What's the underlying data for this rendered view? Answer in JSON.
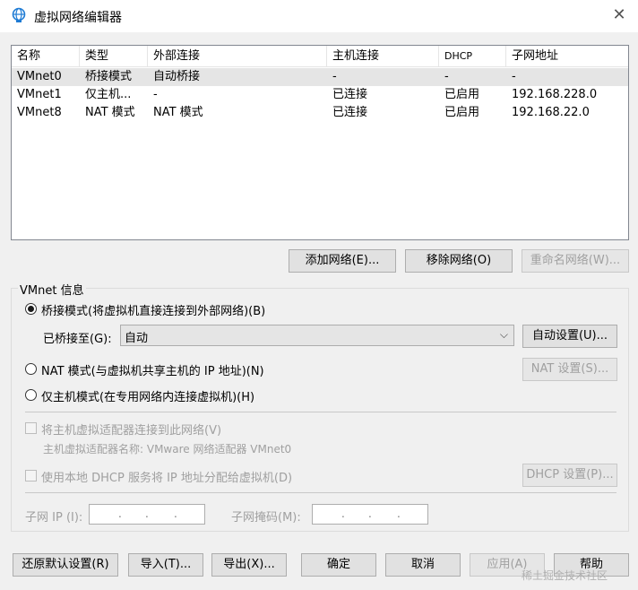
{
  "window": {
    "title": "虚拟网络编辑器",
    "close_glyph": "✕"
  },
  "network_list": {
    "columns": [
      "名称",
      "类型",
      "外部连接",
      "主机连接",
      "DHCP",
      "子网地址"
    ],
    "rows": [
      {
        "name": "VMnet0",
        "type": "桥接模式",
        "external": "自动桥接",
        "host": "-",
        "dhcp": "-",
        "subnet": "-",
        "selected": true
      },
      {
        "name": "VMnet1",
        "type": "仅主机...",
        "external": "-",
        "host": "已连接",
        "dhcp": "已启用",
        "subnet": "192.168.228.0",
        "selected": false
      },
      {
        "name": "VMnet8",
        "type": "NAT 模式",
        "external": "NAT 模式",
        "host": "已连接",
        "dhcp": "已启用",
        "subnet": "192.168.22.0",
        "selected": false
      }
    ]
  },
  "list_buttons": {
    "add": "添加网络(E)...",
    "remove": "移除网络(O)",
    "rename": "重命名网络(W)..."
  },
  "vmnet_info": {
    "group_label": "VMnet 信息",
    "bridged_label": "桥接模式(将虚拟机直接连接到外部网络)(B)",
    "bridged_to_label": "已桥接至(G):",
    "bridged_to_value": "自动",
    "auto_settings": "自动设置(U)...",
    "nat_label": "NAT 模式(与虚拟机共享主机的 IP 地址)(N)",
    "nat_settings": "NAT 设置(S)...",
    "host_only_label": "仅主机模式(在专用网络内连接虚拟机)(H)",
    "connect_adapter_label": "将主机虚拟适配器连接到此网络(V)",
    "adapter_name_label": "主机虚拟适配器名称: VMware 网络适配器 VMnet0",
    "dhcp_label": "使用本地 DHCP 服务将 IP 地址分配给虚拟机(D)",
    "dhcp_settings": "DHCP 设置(P)...",
    "subnet_ip_label": "子网 IP (I):",
    "subnet_mask_label": "子网掩码(M):"
  },
  "footer": {
    "restore": "还原默认设置(R)",
    "import": "导入(T)...",
    "export": "导出(X)...",
    "ok": "确定",
    "cancel": "取消",
    "apply": "应用(A)",
    "help": "帮助"
  },
  "watermark": "稀土掘金技术社区",
  "icons": {
    "title_icon": "network-globe-icon",
    "dropdown": "chevron-down-icon"
  },
  "colors": {
    "dialog_bg": "#f0f0f0",
    "selected_row": "#e5e5e5",
    "disabled_text": "#a0a0a0"
  }
}
